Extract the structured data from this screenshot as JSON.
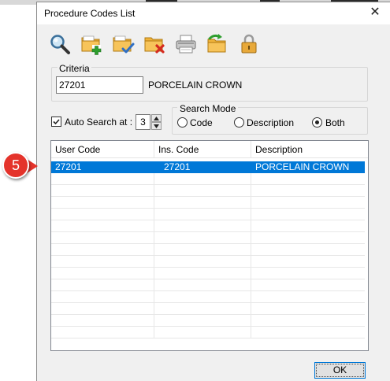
{
  "window": {
    "title": "Procedure Codes List",
    "close_glyph": "✕"
  },
  "toolbar": {
    "buttons": [
      {
        "icon": "search-icon"
      },
      {
        "icon": "add-folder-icon"
      },
      {
        "icon": "edit-folder-icon"
      },
      {
        "icon": "delete-folder-icon"
      },
      {
        "icon": "print-icon"
      },
      {
        "icon": "export-folder-icon"
      },
      {
        "icon": "lock-icon"
      }
    ]
  },
  "criteria": {
    "legend": "Criteria",
    "value": "27201",
    "description": "PORCELAIN CROWN"
  },
  "auto_search": {
    "label": "Auto Search at :",
    "checked": true,
    "value": "3"
  },
  "search_mode": {
    "legend": "Search Mode",
    "options": [
      "Code",
      "Description",
      "Both"
    ],
    "selected": "Both"
  },
  "table": {
    "columns": [
      "User Code",
      "Ins. Code",
      "Description"
    ],
    "rows": [
      [
        "27201",
        "27201",
        "PORCELAIN CROWN"
      ]
    ],
    "selected_row": 0
  },
  "ok_label": "OK",
  "callout": {
    "number": "5"
  },
  "colors": {
    "selection": "#0078d7",
    "callout": "#e4332b"
  }
}
